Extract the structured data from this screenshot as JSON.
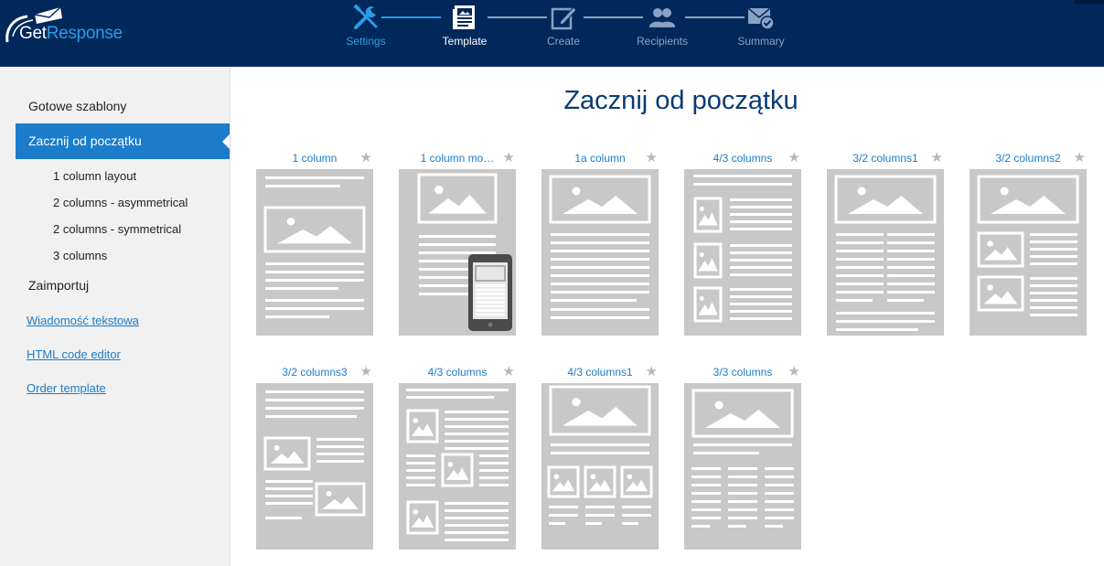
{
  "app": {
    "logo_part1": "Get",
    "logo_part2": "Response",
    "colors": {
      "header_bg": "#00285a",
      "accent": "#1b7ccb",
      "step_done": "#2e9be6",
      "thumb_bg": "#c8c8c8"
    }
  },
  "steps": [
    {
      "label": "Settings",
      "icon": "settings-tools-icon",
      "state": "done"
    },
    {
      "label": "Template",
      "icon": "template-icon",
      "state": "active"
    },
    {
      "label": "Create",
      "icon": "edit-icon",
      "state": "upcoming"
    },
    {
      "label": "Recipients",
      "icon": "users-icon",
      "state": "upcoming"
    },
    {
      "label": "Summary",
      "icon": "envelope-check-icon",
      "state": "upcoming"
    }
  ],
  "sidebar": {
    "ready_templates": "Gotowe szablony",
    "start_scratch": "Zacznij od początku",
    "sub_items": [
      "1 column layout",
      "2 columns - asymmetrical",
      "2 columns - symmetrical",
      "3 columns"
    ],
    "import": "Zaimportuj",
    "links": [
      "Wiadomość tekstowa",
      "HTML code editor",
      "Order template"
    ]
  },
  "main": {
    "title": "Zacznij od początku",
    "templates": [
      {
        "name": "1 column",
        "layout": "one-col"
      },
      {
        "name": "1 column mo…",
        "layout": "one-col-mobile"
      },
      {
        "name": "1a column",
        "layout": "one-col-a"
      },
      {
        "name": "4/3 columns",
        "layout": "left-images"
      },
      {
        "name": "3/2 columns1",
        "layout": "hero-two-col-text"
      },
      {
        "name": "3/2 columns2",
        "layout": "hero-two-img-rows"
      },
      {
        "name": "3/2 columns3",
        "layout": "zigzag"
      },
      {
        "name": "4/3 columns",
        "layout": "left-images-2"
      },
      {
        "name": "4/3 columns1",
        "layout": "hero-three-img"
      },
      {
        "name": "3/3 columns",
        "layout": "hero-three-col-text"
      }
    ]
  }
}
